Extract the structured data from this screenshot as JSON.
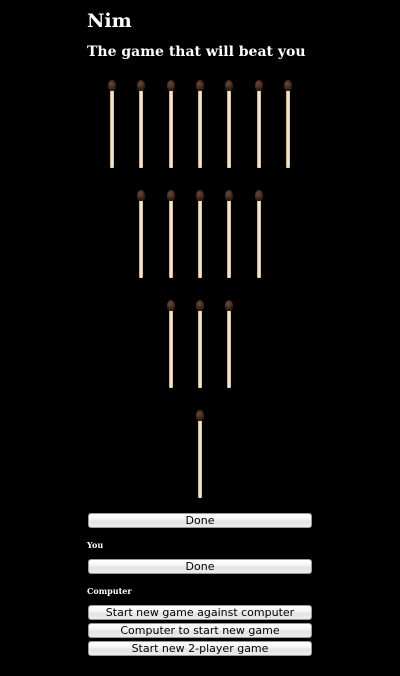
{
  "header": {
    "title": "Nim",
    "subtitle": "The game that will beat you"
  },
  "board": {
    "rows": [
      {
        "count": 7
      },
      {
        "count": 5
      },
      {
        "count": 3
      },
      {
        "count": 1
      }
    ]
  },
  "players": {
    "you": {
      "done_label": "Done",
      "label": "You"
    },
    "computer": {
      "done_label": "Done",
      "label": "Computer"
    }
  },
  "controls": {
    "new_vs_computer": "Start new game against computer",
    "computer_first": "Computer to start new game",
    "new_two_player": "Start new 2-player game"
  }
}
